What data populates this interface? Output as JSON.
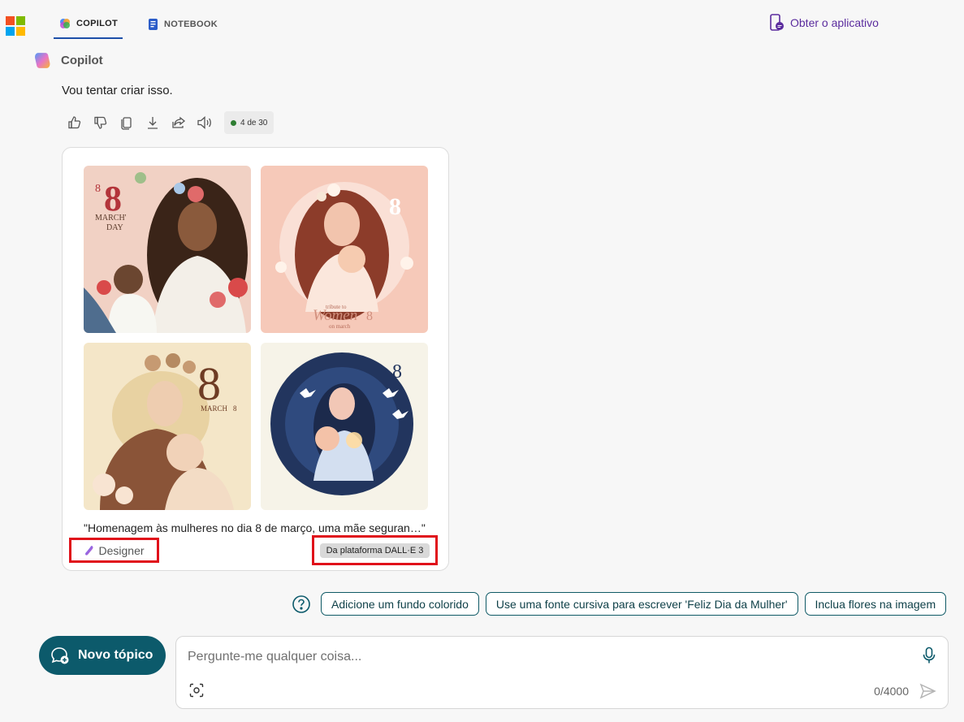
{
  "header": {
    "tabs": [
      {
        "label": "COPILOT",
        "active": true
      },
      {
        "label": "NOTEBOOK",
        "active": false
      }
    ],
    "get_app_label": "Obter o aplicativo",
    "logo_colors": [
      "#f25022",
      "#7fba00",
      "#00a4ef",
      "#ffb900"
    ]
  },
  "message": {
    "sender": "Copilot",
    "text": "Vou tentar criar isso.",
    "counter": "4 de 30",
    "actions": [
      "thumbs-up-icon",
      "thumbs-down-icon",
      "copy-icon",
      "download-icon",
      "share-icon",
      "speaker-icon"
    ]
  },
  "image_card": {
    "image_texts": {
      "img1": {
        "number": "8",
        "small": "8",
        "line1": "MARCH'",
        "line2": "DAY"
      },
      "img2": {
        "line1": "tribute to",
        "word": "Women",
        "num": "8",
        "line2": "on march",
        "corner": "8"
      },
      "img3": {
        "number": "8",
        "sub": "MARCH",
        "sub_num": "8"
      },
      "img4": {
        "number": "8"
      }
    },
    "caption": "\"Homenagem às mulheres no dia 8 de março, uma mãe seguran…\"",
    "designer_label": "Designer",
    "platform_label": "Da plataforma DALL·E 3"
  },
  "suggestions": [
    "Adicione um fundo colorido",
    "Use uma fonte cursiva para escrever 'Feliz Dia da Mulher'",
    "Inclua flores na imagem"
  ],
  "composer": {
    "new_topic_label": "Novo tópico",
    "placeholder": "Pergunte-me qualquer coisa...",
    "char_count": "0/4000"
  }
}
